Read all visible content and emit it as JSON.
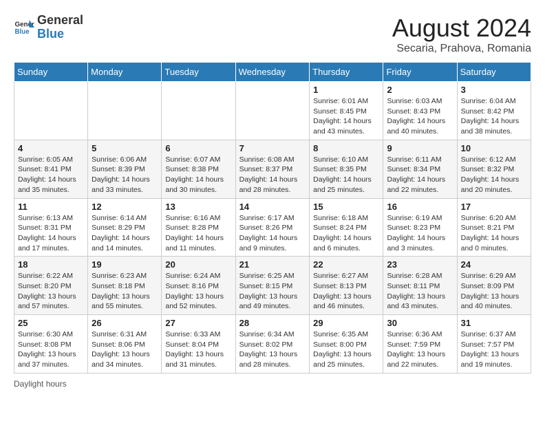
{
  "header": {
    "logo_general": "General",
    "logo_blue": "Blue",
    "title": "August 2024",
    "subtitle": "Secaria, Prahova, Romania"
  },
  "days_of_week": [
    "Sunday",
    "Monday",
    "Tuesday",
    "Wednesday",
    "Thursday",
    "Friday",
    "Saturday"
  ],
  "weeks": [
    [
      {
        "num": "",
        "info": ""
      },
      {
        "num": "",
        "info": ""
      },
      {
        "num": "",
        "info": ""
      },
      {
        "num": "",
        "info": ""
      },
      {
        "num": "1",
        "info": "Sunrise: 6:01 AM\nSunset: 8:45 PM\nDaylight: 14 hours and 43 minutes."
      },
      {
        "num": "2",
        "info": "Sunrise: 6:03 AM\nSunset: 8:43 PM\nDaylight: 14 hours and 40 minutes."
      },
      {
        "num": "3",
        "info": "Sunrise: 6:04 AM\nSunset: 8:42 PM\nDaylight: 14 hours and 38 minutes."
      }
    ],
    [
      {
        "num": "4",
        "info": "Sunrise: 6:05 AM\nSunset: 8:41 PM\nDaylight: 14 hours and 35 minutes."
      },
      {
        "num": "5",
        "info": "Sunrise: 6:06 AM\nSunset: 8:39 PM\nDaylight: 14 hours and 33 minutes."
      },
      {
        "num": "6",
        "info": "Sunrise: 6:07 AM\nSunset: 8:38 PM\nDaylight: 14 hours and 30 minutes."
      },
      {
        "num": "7",
        "info": "Sunrise: 6:08 AM\nSunset: 8:37 PM\nDaylight: 14 hours and 28 minutes."
      },
      {
        "num": "8",
        "info": "Sunrise: 6:10 AM\nSunset: 8:35 PM\nDaylight: 14 hours and 25 minutes."
      },
      {
        "num": "9",
        "info": "Sunrise: 6:11 AM\nSunset: 8:34 PM\nDaylight: 14 hours and 22 minutes."
      },
      {
        "num": "10",
        "info": "Sunrise: 6:12 AM\nSunset: 8:32 PM\nDaylight: 14 hours and 20 minutes."
      }
    ],
    [
      {
        "num": "11",
        "info": "Sunrise: 6:13 AM\nSunset: 8:31 PM\nDaylight: 14 hours and 17 minutes."
      },
      {
        "num": "12",
        "info": "Sunrise: 6:14 AM\nSunset: 8:29 PM\nDaylight: 14 hours and 14 minutes."
      },
      {
        "num": "13",
        "info": "Sunrise: 6:16 AM\nSunset: 8:28 PM\nDaylight: 14 hours and 11 minutes."
      },
      {
        "num": "14",
        "info": "Sunrise: 6:17 AM\nSunset: 8:26 PM\nDaylight: 14 hours and 9 minutes."
      },
      {
        "num": "15",
        "info": "Sunrise: 6:18 AM\nSunset: 8:24 PM\nDaylight: 14 hours and 6 minutes."
      },
      {
        "num": "16",
        "info": "Sunrise: 6:19 AM\nSunset: 8:23 PM\nDaylight: 14 hours and 3 minutes."
      },
      {
        "num": "17",
        "info": "Sunrise: 6:20 AM\nSunset: 8:21 PM\nDaylight: 14 hours and 0 minutes."
      }
    ],
    [
      {
        "num": "18",
        "info": "Sunrise: 6:22 AM\nSunset: 8:20 PM\nDaylight: 13 hours and 57 minutes."
      },
      {
        "num": "19",
        "info": "Sunrise: 6:23 AM\nSunset: 8:18 PM\nDaylight: 13 hours and 55 minutes."
      },
      {
        "num": "20",
        "info": "Sunrise: 6:24 AM\nSunset: 8:16 PM\nDaylight: 13 hours and 52 minutes."
      },
      {
        "num": "21",
        "info": "Sunrise: 6:25 AM\nSunset: 8:15 PM\nDaylight: 13 hours and 49 minutes."
      },
      {
        "num": "22",
        "info": "Sunrise: 6:27 AM\nSunset: 8:13 PM\nDaylight: 13 hours and 46 minutes."
      },
      {
        "num": "23",
        "info": "Sunrise: 6:28 AM\nSunset: 8:11 PM\nDaylight: 13 hours and 43 minutes."
      },
      {
        "num": "24",
        "info": "Sunrise: 6:29 AM\nSunset: 8:09 PM\nDaylight: 13 hours and 40 minutes."
      }
    ],
    [
      {
        "num": "25",
        "info": "Sunrise: 6:30 AM\nSunset: 8:08 PM\nDaylight: 13 hours and 37 minutes."
      },
      {
        "num": "26",
        "info": "Sunrise: 6:31 AM\nSunset: 8:06 PM\nDaylight: 13 hours and 34 minutes."
      },
      {
        "num": "27",
        "info": "Sunrise: 6:33 AM\nSunset: 8:04 PM\nDaylight: 13 hours and 31 minutes."
      },
      {
        "num": "28",
        "info": "Sunrise: 6:34 AM\nSunset: 8:02 PM\nDaylight: 13 hours and 28 minutes."
      },
      {
        "num": "29",
        "info": "Sunrise: 6:35 AM\nSunset: 8:00 PM\nDaylight: 13 hours and 25 minutes."
      },
      {
        "num": "30",
        "info": "Sunrise: 6:36 AM\nSunset: 7:59 PM\nDaylight: 13 hours and 22 minutes."
      },
      {
        "num": "31",
        "info": "Sunrise: 6:37 AM\nSunset: 7:57 PM\nDaylight: 13 hours and 19 minutes."
      }
    ]
  ],
  "footer": {
    "daylight_label": "Daylight hours"
  }
}
